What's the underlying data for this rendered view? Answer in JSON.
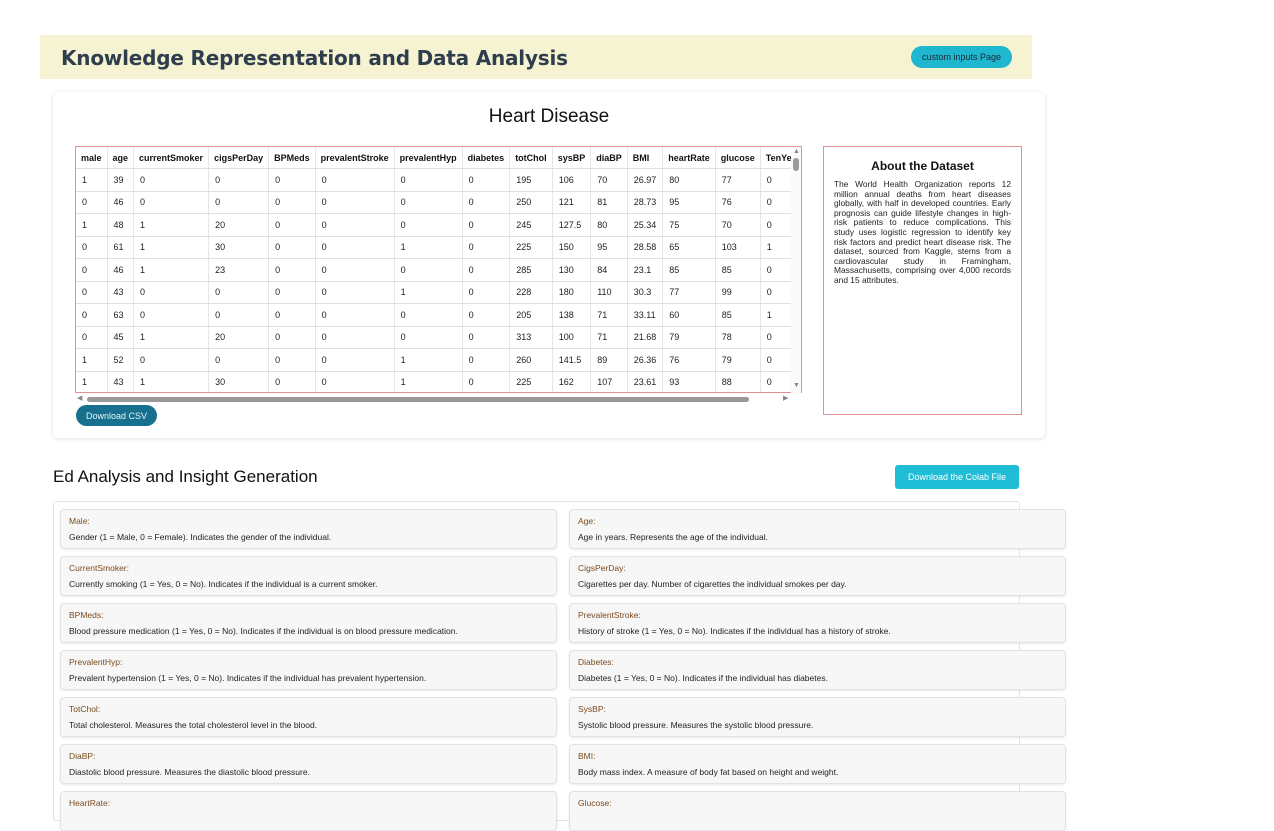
{
  "header": {
    "title": "Knowledge Representation and Data Analysis",
    "nav_button": "custom inputs Page"
  },
  "dataset": {
    "title": "Heart Disease",
    "columns": [
      "male",
      "age",
      "currentSmoker",
      "cigsPerDay",
      "BPMeds",
      "prevalentStroke",
      "prevalentHyp",
      "diabetes",
      "totChol",
      "sysBP",
      "diaBP",
      "BMI",
      "heartRate",
      "glucose",
      "TenYe"
    ],
    "rows": [
      [
        "1",
        "39",
        "0",
        "0",
        "0",
        "0",
        "0",
        "0",
        "195",
        "106",
        "70",
        "26.97",
        "80",
        "77",
        "0"
      ],
      [
        "0",
        "46",
        "0",
        "0",
        "0",
        "0",
        "0",
        "0",
        "250",
        "121",
        "81",
        "28.73",
        "95",
        "76",
        "0"
      ],
      [
        "1",
        "48",
        "1",
        "20",
        "0",
        "0",
        "0",
        "0",
        "245",
        "127.5",
        "80",
        "25.34",
        "75",
        "70",
        "0"
      ],
      [
        "0",
        "61",
        "1",
        "30",
        "0",
        "0",
        "1",
        "0",
        "225",
        "150",
        "95",
        "28.58",
        "65",
        "103",
        "1"
      ],
      [
        "0",
        "46",
        "1",
        "23",
        "0",
        "0",
        "0",
        "0",
        "285",
        "130",
        "84",
        "23.1",
        "85",
        "85",
        "0"
      ],
      [
        "0",
        "43",
        "0",
        "0",
        "0",
        "0",
        "1",
        "0",
        "228",
        "180",
        "110",
        "30.3",
        "77",
        "99",
        "0"
      ],
      [
        "0",
        "63",
        "0",
        "0",
        "0",
        "0",
        "0",
        "0",
        "205",
        "138",
        "71",
        "33.11",
        "60",
        "85",
        "1"
      ],
      [
        "0",
        "45",
        "1",
        "20",
        "0",
        "0",
        "0",
        "0",
        "313",
        "100",
        "71",
        "21.68",
        "79",
        "78",
        "0"
      ],
      [
        "1",
        "52",
        "0",
        "0",
        "0",
        "0",
        "1",
        "0",
        "260",
        "141.5",
        "89",
        "26.36",
        "76",
        "79",
        "0"
      ],
      [
        "1",
        "43",
        "1",
        "30",
        "0",
        "0",
        "1",
        "0",
        "225",
        "162",
        "107",
        "23.61",
        "93",
        "88",
        "0"
      ]
    ],
    "download_csv": "Download CSV"
  },
  "about": {
    "title": "About the Dataset",
    "text": "The World Health Organization reports 12 million annual deaths from heart diseases globally, with half in developed countries. Early prognosis can guide lifestyle changes in high-risk patients to reduce complications. This study uses logistic regression to identify key risk factors and predict heart disease risk. The dataset, sourced from Kaggle, stems from a cardiovascular study in Framingham, Massachusetts, comprising over 4,000 records and 15 attributes."
  },
  "analysis": {
    "title": "Ed Analysis and Insight Generation",
    "colab_button": "Download the Colab File",
    "attributes": [
      {
        "name": "Male:",
        "desc": "Gender (1 = Male, 0 = Female). Indicates the gender of the individual."
      },
      {
        "name": "Age:",
        "desc": "Age in years. Represents the age of the individual."
      },
      {
        "name": "CurrentSmoker:",
        "desc": "Currently smoking (1 = Yes, 0 = No). Indicates if the individual is a current smoker."
      },
      {
        "name": "CigsPerDay:",
        "desc": "Cigarettes per day. Number of cigarettes the individual smokes per day."
      },
      {
        "name": "BPMeds:",
        "desc": "Blood pressure medication (1 = Yes, 0 = No). Indicates if the individual is on blood pressure medication."
      },
      {
        "name": "PrevalentStroke:",
        "desc": "History of stroke (1 = Yes, 0 = No). Indicates if the individual has a history of stroke."
      },
      {
        "name": "PrevalentHyp:",
        "desc": "Prevalent hypertension (1 = Yes, 0 = No). Indicates if the individual has prevalent hypertension."
      },
      {
        "name": "Diabetes:",
        "desc": "Diabetes (1 = Yes, 0 = No). Indicates if the individual has diabetes."
      },
      {
        "name": "TotChol:",
        "desc": "Total cholesterol. Measures the total cholesterol level in the blood."
      },
      {
        "name": "SysBP:",
        "desc": "Systolic blood pressure. Measures the systolic blood pressure."
      },
      {
        "name": "DiaBP:",
        "desc": "Diastolic blood pressure. Measures the diastolic blood pressure."
      },
      {
        "name": "BMI:",
        "desc": "Body mass index. A measure of body fat based on height and weight."
      },
      {
        "name": "HeartRate:",
        "desc": ""
      },
      {
        "name": "Glucose:",
        "desc": ""
      }
    ]
  }
}
